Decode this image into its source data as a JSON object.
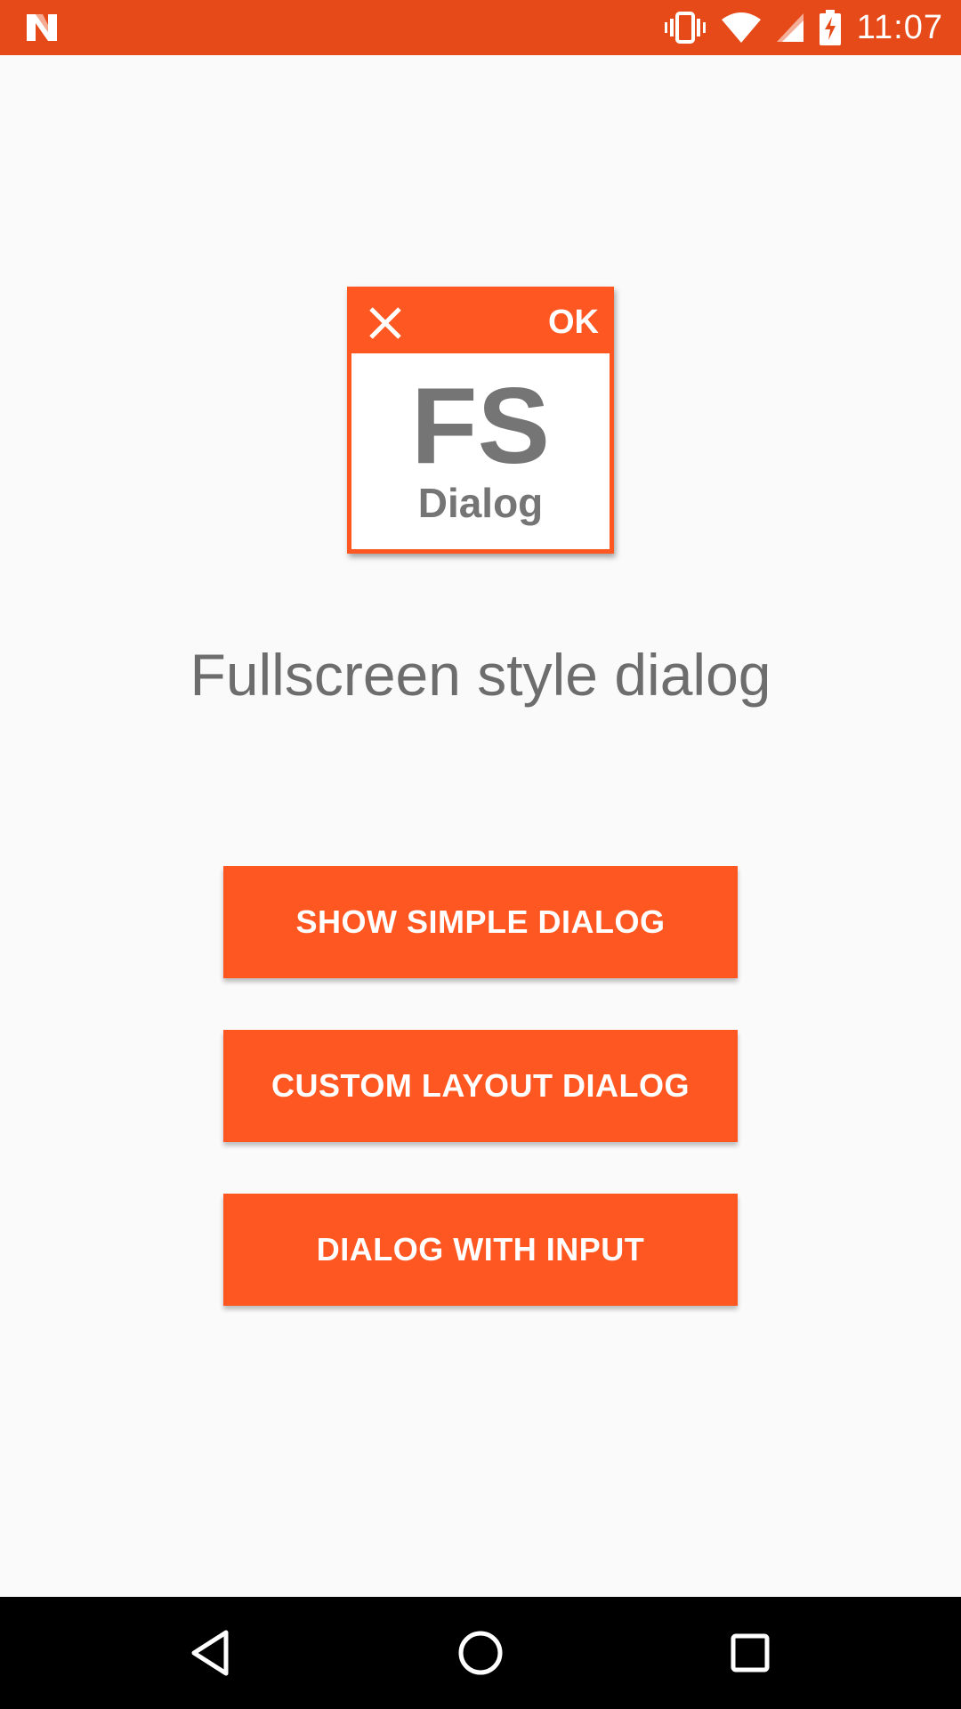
{
  "status_bar": {
    "time": "11:07",
    "icons": [
      "android-n-icon",
      "vibrate-icon",
      "wifi-icon",
      "signal-icon",
      "battery-charging-icon"
    ],
    "color": "#e64a19"
  },
  "logo": {
    "ok_label": "OK",
    "fs_label": "FS",
    "dialog_label": "Dialog",
    "accent": "#ff5722",
    "text_color": "#757575"
  },
  "headline": "Fullscreen style dialog",
  "buttons": [
    {
      "label": "SHOW SIMPLE DIALOG"
    },
    {
      "label": "CUSTOM LAYOUT DIALOG"
    },
    {
      "label": "DIALOG WITH INPUT"
    }
  ],
  "button_color": "#ff5722",
  "nav_bar": {
    "icons": [
      "back-icon",
      "home-icon",
      "recents-icon"
    ]
  }
}
